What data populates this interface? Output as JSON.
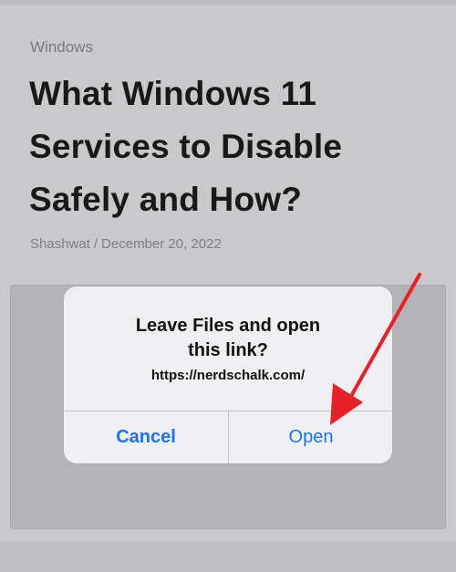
{
  "article": {
    "category": "Windows",
    "title_lines": [
      "What Windows 11",
      "Services to Disable",
      "Safely and How?"
    ],
    "author": "Shashwat",
    "separator": "/",
    "date": "December 20, 2022"
  },
  "dialog": {
    "title_lines": [
      "Leave Files and open",
      "this link?"
    ],
    "url": "https://nerdschalk.com/",
    "cancel_label": "Cancel",
    "open_label": "Open"
  },
  "annotation": {
    "arrow_color": "#e8202a",
    "icon": "red-arrow-icon"
  },
  "colors": {
    "background": "#c9c9cb",
    "dialog_background": "#efeff1",
    "button_text": "#1a73e8"
  }
}
